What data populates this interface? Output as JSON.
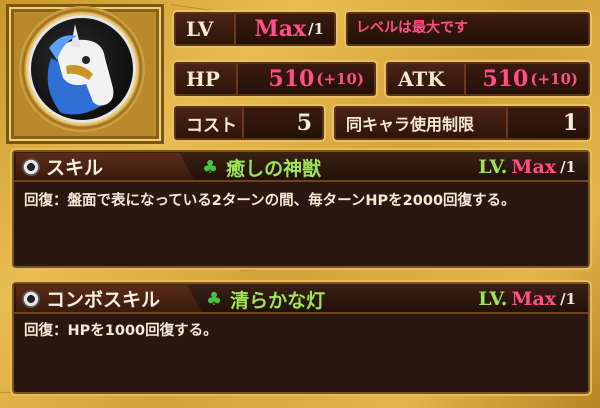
{
  "status": {
    "lv_label": "LV",
    "lv_value": "Max",
    "lv_suffix": "/1",
    "lv_note": "レベルは最大です",
    "hp_label": "HP",
    "hp_value": "510",
    "hp_bonus": "(+10)",
    "atk_label": "ATK",
    "atk_value": "510",
    "atk_bonus": "(+10)",
    "cost_label": "コスト",
    "cost_value": "5",
    "limit_label": "同キャラ使用制限",
    "limit_value": "1"
  },
  "skill": {
    "header": "スキル",
    "name": "癒しの神獣",
    "lv_prefix": "LV.",
    "lv_value": "Max",
    "lv_suffix": "/1",
    "description": "回復：盤面で表になっている2ターンの間、毎ターンHPを2000回復する。"
  },
  "combo": {
    "header": "コンボスキル",
    "name": "清らかな灯",
    "lv_prefix": "LV.",
    "lv_value": "Max",
    "lv_suffix": "/1",
    "description": "回復：HPを1000回復する。"
  },
  "icons": {
    "portrait": "unicorn-portrait-icon",
    "skill_icon": "disc-icon",
    "combo_icon": "combo-disc-icon",
    "leaf": "clover-icon"
  },
  "colors": {
    "accent_pink": "#ff4f86",
    "accent_green": "#9ee35a",
    "gold": "#e8bd52",
    "panel": "#2a1710"
  }
}
